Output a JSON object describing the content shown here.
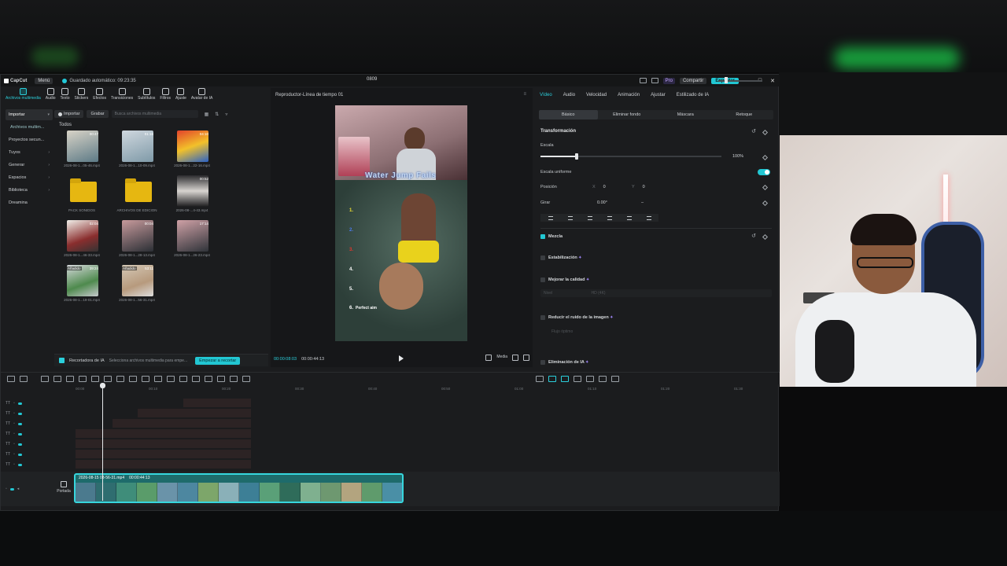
{
  "app": {
    "logo_text": "CapCut",
    "menu_label": "Menú",
    "autosave_text": "Guardado automático: 09:23:35",
    "project_title": "0809",
    "pro_label": "Pro",
    "share_label": "Compartir",
    "export_label": "Exportar",
    "accent_color": "#22c7d3"
  },
  "toolbar": {
    "tools": [
      {
        "label": "Archivos multimedia",
        "icon": "media-icon"
      },
      {
        "label": "Audio",
        "icon": "audio-icon"
      },
      {
        "label": "Texto",
        "icon": "text-icon"
      },
      {
        "label": "Stickers",
        "icon": "sticker-icon"
      },
      {
        "label": "Efectos",
        "icon": "effects-icon"
      },
      {
        "label": "Transiciones",
        "icon": "transitions-icon"
      },
      {
        "label": "Subtítulos",
        "icon": "subtitles-icon"
      },
      {
        "label": "Filtros",
        "icon": "filters-icon"
      },
      {
        "label": "Ajuste",
        "icon": "adjust-icon"
      },
      {
        "label": "Avatar de IA",
        "icon": "avatar-icon"
      }
    ]
  },
  "left_nav": {
    "items": [
      "Importar",
      "Archivos multim...",
      "Proyectos secun...",
      "Tuyos",
      "Generar",
      "Espacios",
      "Biblioteca",
      "Dreamina"
    ]
  },
  "media": {
    "import_label": "Importar",
    "record_label": "Grabar",
    "search_placeholder": "Busca archivos multimedia",
    "all_label": "Todos",
    "tiles": [
      {
        "name": "2026-08-1...05-46.mp4",
        "duration": "00:47",
        "added": ""
      },
      {
        "name": "2026-08-1...10-09.mp4",
        "duration": "01:16",
        "added": ""
      },
      {
        "name": "2026-08-1...22-16.mp4",
        "duration": "04:10",
        "added": ""
      },
      {
        "name": "PACK SONIDOS",
        "duration": "",
        "added": ""
      },
      {
        "name": "ARCHIVOS DE EDICION",
        "duration": "",
        "added": ""
      },
      {
        "name": "2026-08-...4-43.mp4",
        "duration": "00:52",
        "added": ""
      },
      {
        "name": "2026-08-1...46-33.mp4",
        "duration": "02:04",
        "added": ""
      },
      {
        "name": "2026-08-1...28-13.mp4",
        "duration": "00:04",
        "added": ""
      },
      {
        "name": "2026-08-1...26-23.mp4",
        "duration": "17:14",
        "added": ""
      },
      {
        "name": "2026-08-1...19-01.mp4",
        "duration": "39:24",
        "added": "Añadido"
      },
      {
        "name": "2026-08-1...56-31.mp4",
        "duration": "53:11",
        "added": "Añadido"
      }
    ]
  },
  "ai_cutter": {
    "title": "Recortadora de IA",
    "hint": "Selecciona archivos multimedia para empe...",
    "button": "Empezar a recortar"
  },
  "player": {
    "title": "Reproductor-Línea de tiempo 01",
    "current_time": "00:00:08:03",
    "total_time": "00:00:44:13",
    "overlay_title": "Water Jump Fails",
    "overlay_numbers": [
      "1.",
      "2.",
      "3.",
      "4.",
      "5.",
      "6."
    ],
    "overlay_caption": "Perfect aim",
    "ratio_label": "Media"
  },
  "inspector": {
    "tabs": [
      "Vídeo",
      "Audio",
      "Velocidad",
      "Animación",
      "Ajustar",
      "Estilizado de IA"
    ],
    "sub_tabs": [
      "Básico",
      "Eliminar fondo",
      "Máscara",
      "Retoque"
    ],
    "transform_title": "Transformación",
    "scale_label": "Escala",
    "scale_value": "100%",
    "scale_fraction": 0.2,
    "uniform_label": "Escala uniforme",
    "position_label": "Posición",
    "pos_x_axis": "X",
    "pos_x": "0",
    "pos_y_axis": "Y",
    "pos_y": "0",
    "rotate_label": "Girar",
    "rotate_value": "0.00°",
    "rotate_dash": "–",
    "blend_label": "Mezcla",
    "stabilize_label": "Estabilización",
    "quality_label": "Mejorar la calidad",
    "quality_level_label": "Nivel",
    "quality_level_value": "HD (4K)",
    "denoise_label": "Reducir el ruido de la imagen",
    "denoise_sub": "Flujo óptimo",
    "flicker_label": "Eliminación de IA"
  },
  "timeline": {
    "ruler_ticks": [
      "00:00",
      "00:10",
      "00:20",
      "00:30",
      "00:40",
      "00:50",
      "01:00",
      "01:10",
      "01:20",
      "01:30"
    ],
    "cover_label": "Portada",
    "clip_name": "2026-08-15 03-56-31.mp4",
    "clip_duration": "00:00:44:13"
  }
}
